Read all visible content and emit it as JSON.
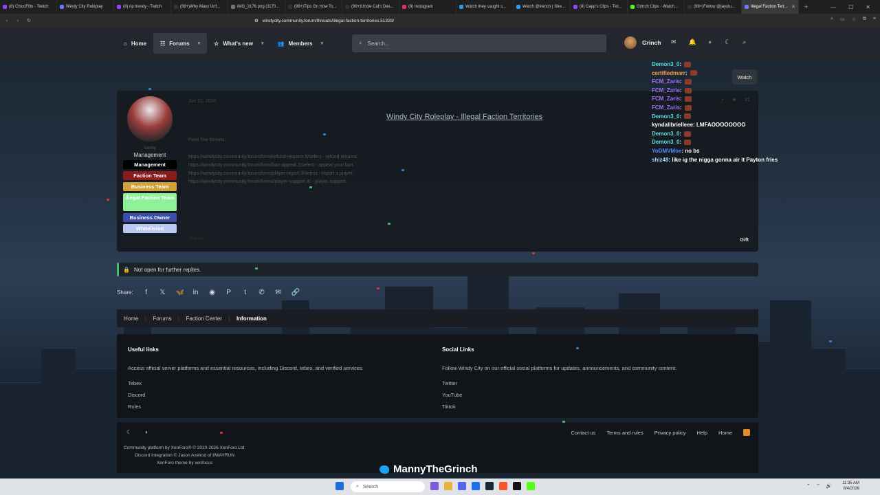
{
  "browser": {
    "tabs": [
      {
        "label": "(8) ChicoFillo - Twitch",
        "color": "#9146ff"
      },
      {
        "label": "Windy City Roleplay",
        "color": "#6b7cff"
      },
      {
        "label": "(8) rip trendy - Twitch",
        "color": "#9146ff"
      },
      {
        "label": "(99+)Why Maxx Unf...",
        "color": "#333333"
      },
      {
        "label": "IMG_3176.png (1170...",
        "color": "#777777"
      },
      {
        "label": "(99+)Tips On How To...",
        "color": "#333333"
      },
      {
        "label": "(99+)Uncle Cal's Des...",
        "color": "#333333"
      },
      {
        "label": "(9) Instagram",
        "color": "#e1306c"
      },
      {
        "label": "Watch they caught s...",
        "color": "#2a9df4"
      },
      {
        "label": "Watch @trench | Stre...",
        "color": "#2a9df4"
      },
      {
        "label": "(8) Capp's Clips - Twi...",
        "color": "#9146ff"
      },
      {
        "label": "Grinch Clips - Watch...",
        "color": "#53fc18"
      },
      {
        "label": "(99+)Follow @jaystu...",
        "color": "#333333"
      },
      {
        "label": "Illegal Faction Terr...",
        "color": "#6b7cff"
      }
    ],
    "url": "windycity.community.forum/threads/illegal-faction-territories.51328/"
  },
  "nav": {
    "home": "Home",
    "forums": "Forums",
    "whats_new": "What's new",
    "members": "Members",
    "search_placeholder": "Search...",
    "username": "Grinch"
  },
  "post": {
    "date": "Jun 21, 2026",
    "number": "#1",
    "author": "Vanity",
    "author_title": "Management",
    "title": "Windy City Roleplay - Illegal Faction Territories",
    "tagline": "Feed The Streets.",
    "lines": [
      "https://windycity.community.forum/form/refund-request.5/select - refund request.",
      "https://windycity.community.forum/form/ban-appeal.2/select - appeal your ban.",
      "https://windycity.community.forum/form/player-report.3/select - report a player.",
      "https://windycity.community.forum/forms/player-support.4/ - player support."
    ],
    "report": "Report",
    "gift": "Gift",
    "badges": [
      {
        "label": "Management",
        "bg": "#000000",
        "fg": "#ffffff"
      },
      {
        "label": "Faction Team",
        "bg": "#8b1c1c",
        "fg": "#ffffff"
      },
      {
        "label": "Business Team",
        "bg": "#d1a23a",
        "fg": "#ffffff"
      },
      {
        "label": "Illegal Faction Team",
        "bg": "#8ff29a",
        "fg": "#ffffff"
      },
      {
        "label": "Business Owner",
        "bg": "#3b4fa8",
        "fg": "#ffffff"
      },
      {
        "label": "Whitelisted",
        "bg": "#b9c9f2",
        "fg": "#ffffff"
      }
    ]
  },
  "watch_label": "Watch",
  "chat": [
    {
      "user": "Demon3_0",
      "msg": "",
      "color": "#5ce1e6",
      "emote": true
    },
    {
      "user": "certifiedmarr",
      "msg": "",
      "color": "#ff9f43",
      "emote": true
    },
    {
      "user": "FCM_Zaris",
      "msg": "",
      "color": "#a66cff",
      "emote": true
    },
    {
      "user": "FCM_Zaris",
      "msg": "",
      "color": "#a66cff",
      "emote": true
    },
    {
      "user": "FCM_Zaris",
      "msg": "",
      "color": "#a66cff",
      "emote": true
    },
    {
      "user": "FCM_Zaris",
      "msg": "",
      "color": "#a66cff",
      "emote": true
    },
    {
      "user": "Demon3_0",
      "msg": "",
      "color": "#5ce1e6",
      "emote": true
    },
    {
      "user": "kyndallbrielleee",
      "msg": "LMFAOOOOOOOO",
      "color": "#ffffff",
      "emote": false
    },
    {
      "user": "Demon3_0",
      "msg": "",
      "color": "#5ce1e6",
      "emote": true
    },
    {
      "user": "Demon3_0",
      "msg": "",
      "color": "#5ce1e6",
      "emote": true
    },
    {
      "user": "YoDMVMoe",
      "msg": "no bs",
      "color": "#4f8cff",
      "emote": false
    },
    {
      "user": "shiz48",
      "msg": "like ig the nigga gonna air it Payton fries",
      "color": "#9fd3ff",
      "emote": false
    }
  ],
  "closed_notice": "Not open for further replies.",
  "share_label": "Share:",
  "breadcrumbs": [
    "Home",
    "Forums",
    "Faction Center",
    "Information"
  ],
  "footer": {
    "useful_title": "Useful links",
    "useful_desc": "Access official server platforms and essential resources, including Discord, tebex, and verified services.",
    "useful_links": [
      "Tebex",
      "Discord",
      "Rules"
    ],
    "social_title": "Social Links",
    "social_desc": "Follow Windy City on our official social platforms for updates, announcements, and community content.",
    "social_links": [
      "Twitter",
      "YouTube",
      "Tiktok"
    ],
    "links": [
      "Contact us",
      "Terms and rules",
      "Privacy policy",
      "Help",
      "Home"
    ],
    "credit1": "Community platform by XenForo® © 2010-2026 XenForo Ltd.",
    "credit2": "Discord Integration © Jason Axelrod of 8WAYRUN",
    "credit3": "XenForo theme by xenfocus"
  },
  "overlay_text": "MannyTheGrinch",
  "taskbar": {
    "search": "Search",
    "time": "11:35 AM",
    "date": "8/4/2026"
  }
}
